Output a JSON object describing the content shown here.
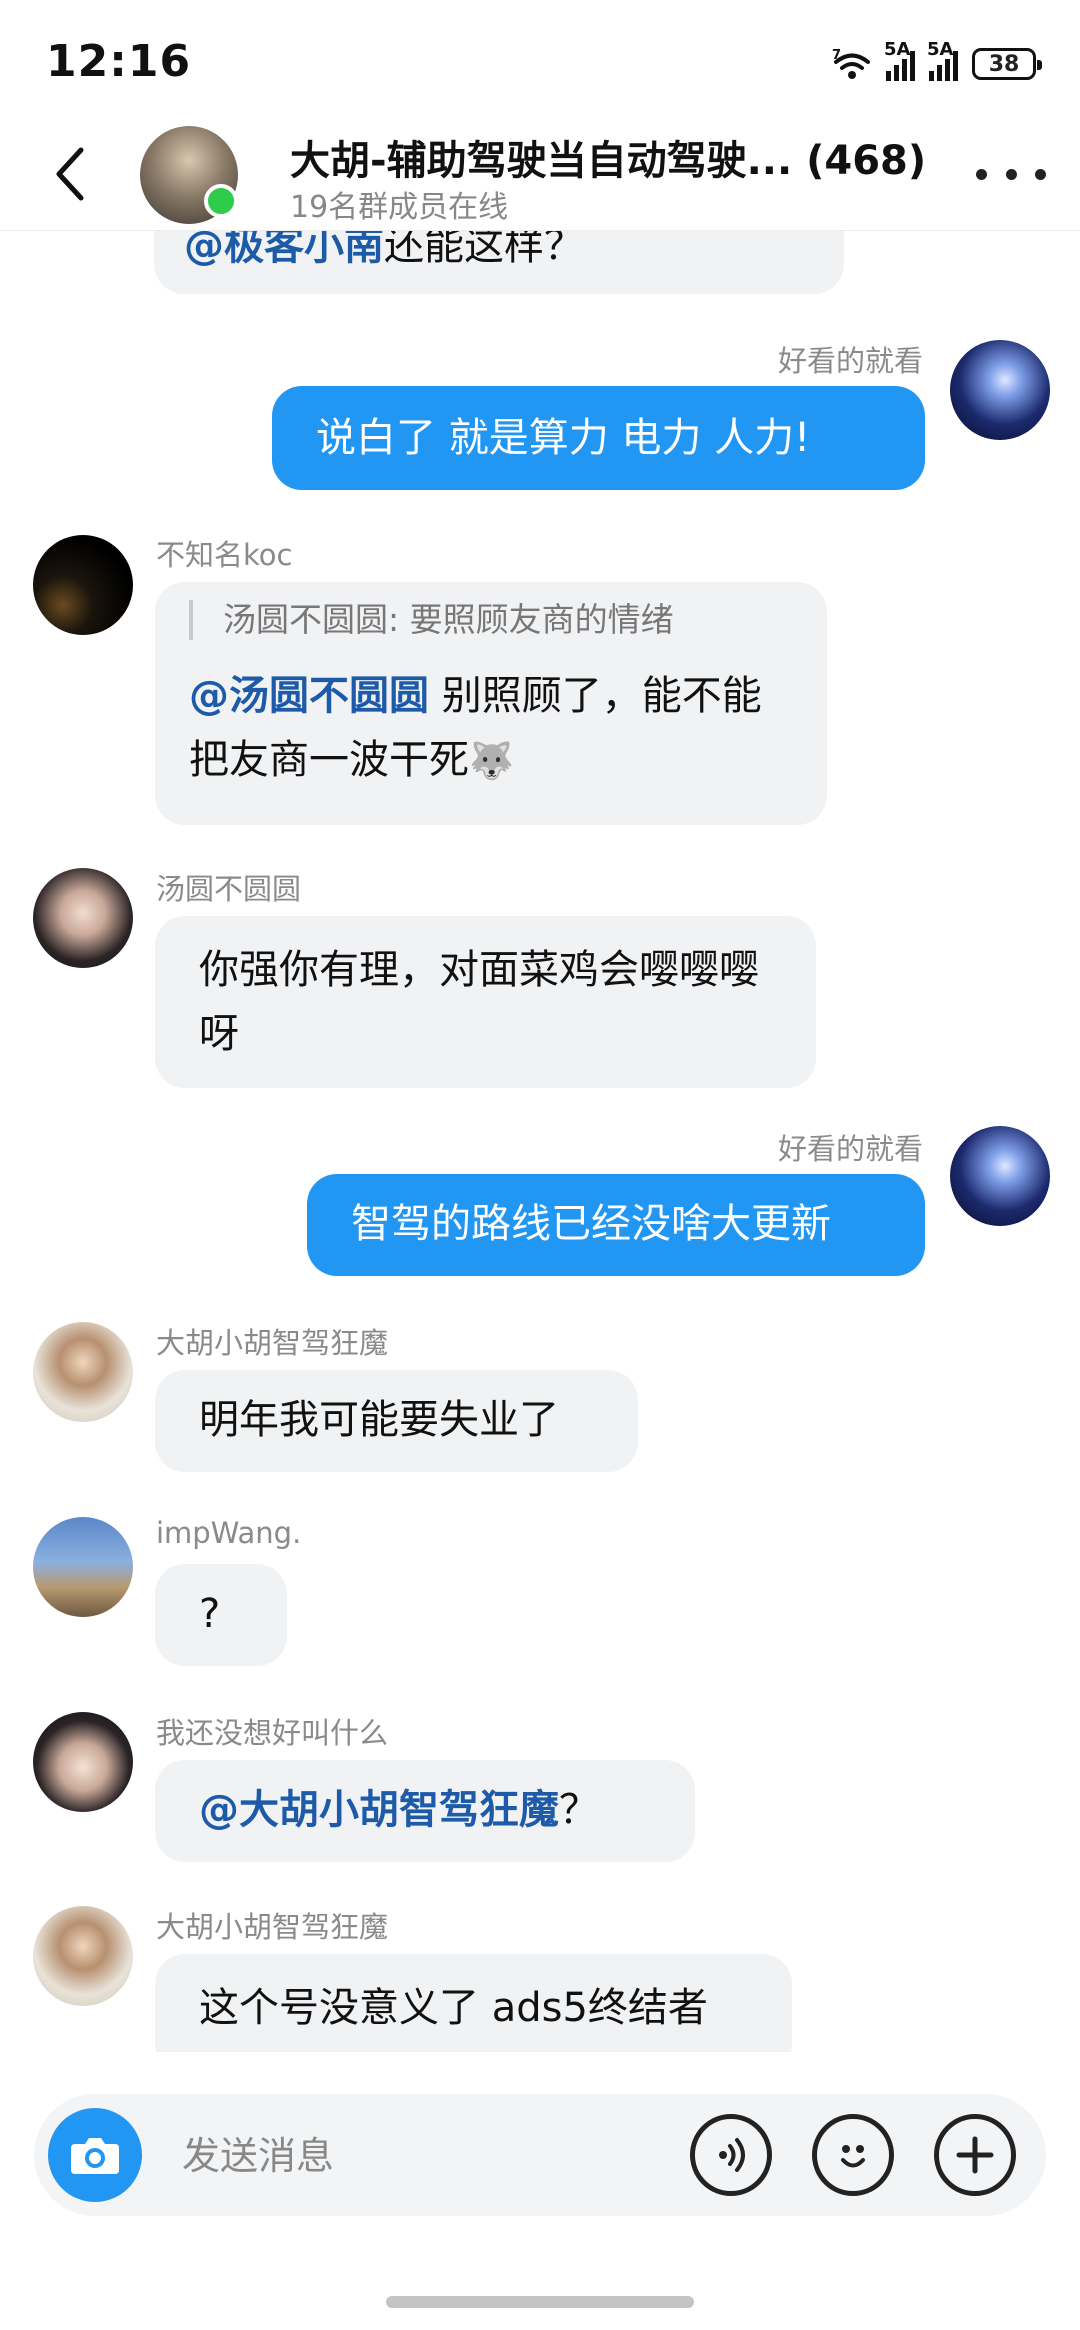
{
  "status_bar": {
    "time": "12:16",
    "wifi_badge": "7",
    "sim1_label": "5A",
    "sim2_label": "5A",
    "battery": "38"
  },
  "header": {
    "title": "大胡-辅助驾驶当自动驾驶... (468)",
    "subtitle": "19名群成员在线"
  },
  "messages": [
    {
      "direction": "in",
      "partial_text": "还能这样？",
      "partial_mention": "@极客小南"
    },
    {
      "direction": "out",
      "sender": "好看的就看",
      "text": "说白了 就是算力 电力 人力!"
    },
    {
      "direction": "in",
      "sender": "不知名koc",
      "quote": "汤圆不圆圆: 要照顾友商的情绪",
      "mention": "@汤圆不圆圆",
      "text": " 别照顾了，能不能把友商一波干死"
    },
    {
      "direction": "in",
      "sender": "汤圆不圆圆",
      "text": "你强你有理，对面菜鸡会嘤嘤嘤呀"
    },
    {
      "direction": "out",
      "sender": "好看的就看",
      "text": "智驾的路线已经没啥大更新"
    },
    {
      "direction": "in",
      "sender": "大胡小胡智驾狂魔",
      "text": "明年我可能要失业了"
    },
    {
      "direction": "in",
      "sender": "impWang.",
      "text": "?"
    },
    {
      "direction": "in",
      "sender": "我还没想好叫什么",
      "mention": "@大胡小胡智驾狂魔",
      "text": "？"
    },
    {
      "direction": "in",
      "sender": "大胡小胡智驾狂魔",
      "text": "这个号没意义了 ads5终结者"
    }
  ],
  "input": {
    "placeholder": "发送消息"
  },
  "icons": {
    "back": "chevron-left-icon",
    "more": "more-dots-icon",
    "camera": "camera-icon",
    "voice": "voice-icon",
    "emoji": "emoji-icon",
    "plus": "plus-icon"
  },
  "colors": {
    "outgoing_bubble": "#2296f3",
    "incoming_bubble": "#f1f2f4",
    "mention": "#1d5aa8",
    "online": "#2ecc4a"
  }
}
